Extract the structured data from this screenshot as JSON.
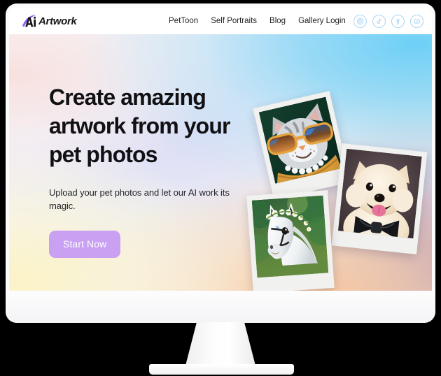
{
  "site": {
    "logo": {
      "mark_icon": "ai-swoosh-icon",
      "wordmark": "Artwork",
      "mark_text": "Ai",
      "accent_color": "#8b5cf6"
    },
    "nav": {
      "items": [
        {
          "label": "PetToon"
        },
        {
          "label": "Self Portraits"
        },
        {
          "label": "Blog"
        },
        {
          "label": "Gallery Login"
        }
      ]
    },
    "social": {
      "items": [
        {
          "icon": "instagram-icon",
          "label": "Instagram"
        },
        {
          "icon": "tiktok-icon",
          "label": "TikTok"
        },
        {
          "icon": "facebook-icon",
          "label": "Facebook"
        },
        {
          "icon": "youtube-icon",
          "label": "YouTube"
        }
      ],
      "color": "#a8d4f3"
    }
  },
  "hero": {
    "headline": "Create amazing artwork from your pet photos",
    "subhead": "Upload your pet photos and let our AI work its magic.",
    "cta_label": "Start Now",
    "cta_color": "#c9a0f2",
    "gradient": {
      "top_right": "#68cef7",
      "bottom_left": "#fdf3c4",
      "bottom_center": "#f9c596",
      "right_edge": "#a385b0",
      "top_left": "#f9dfdb"
    },
    "photos": [
      {
        "name": "cat-sunglasses",
        "alt": "Tabby cat wearing orange sunglasses and a pearl necklace",
        "background": "#0d3024"
      },
      {
        "name": "dog-bowtie",
        "alt": "Cream Pomeranian dog wearing a black bow tie",
        "background": "#463a3e"
      },
      {
        "name": "horse-flower-crown",
        "alt": "White horse wearing a daisy flower crown in a green forest",
        "background": "#2f5a33"
      }
    ]
  },
  "device": {
    "type": "desktop-monitor",
    "body_color": "#fbfbfc"
  }
}
